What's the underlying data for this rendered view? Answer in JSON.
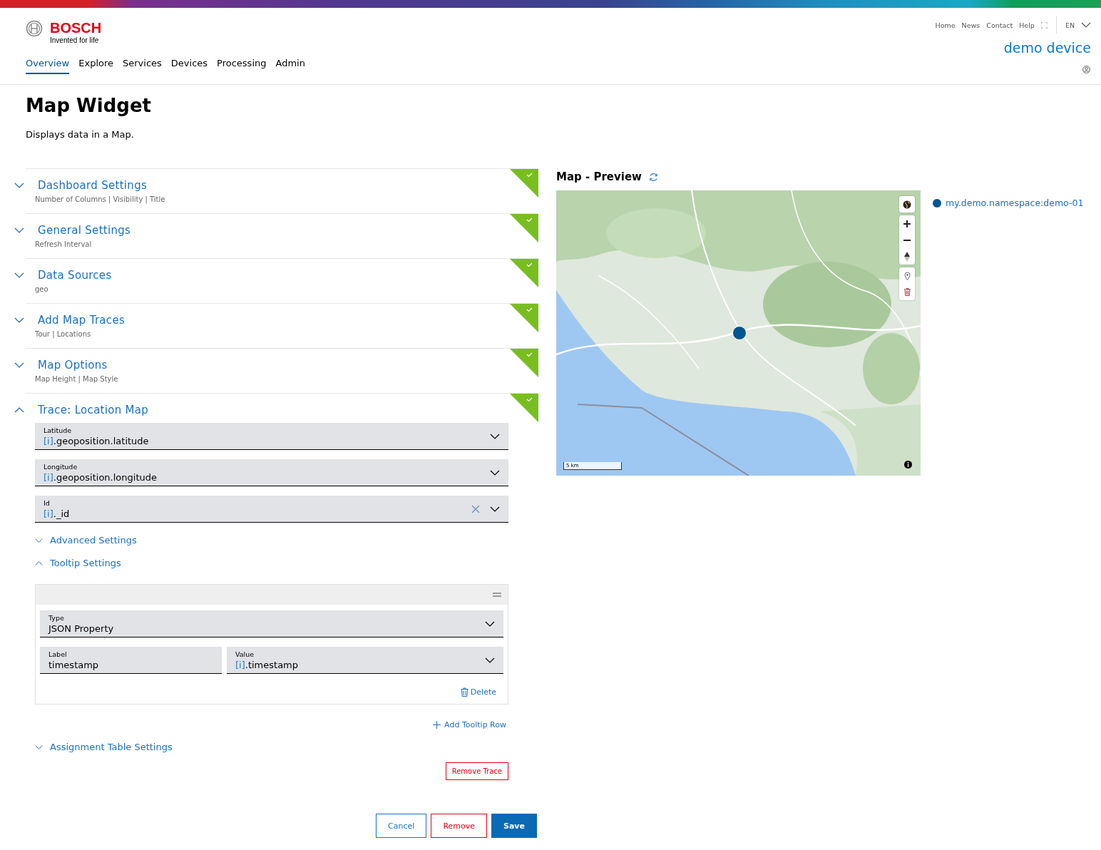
{
  "brand": {
    "name": "BOSCH",
    "tagline": "Invented for life"
  },
  "util_links": [
    "Home",
    "News",
    "Contact",
    "Help"
  ],
  "language": "EN",
  "device": "demo device",
  "nav": [
    {
      "label": "Overview",
      "selected": true
    },
    {
      "label": "Explore",
      "selected": false
    },
    {
      "label": "Services",
      "selected": false
    },
    {
      "label": "Devices",
      "selected": false
    },
    {
      "label": "Processing",
      "selected": false
    },
    {
      "label": "Admin",
      "selected": false
    }
  ],
  "page": {
    "title": "Map Widget",
    "description": "Displays data in a Map."
  },
  "sections": [
    {
      "title": "Dashboard Settings",
      "subtitle": "Number of Columns | Visibility | Title",
      "expanded": false,
      "complete": true
    },
    {
      "title": "General Settings",
      "subtitle": "Refresh Interval",
      "expanded": false,
      "complete": true
    },
    {
      "title": "Data Sources",
      "subtitle": "geo",
      "expanded": false,
      "complete": true
    },
    {
      "title": "Add Map Traces",
      "subtitle": "Tour | Locations",
      "expanded": false,
      "complete": true
    },
    {
      "title": "Map Options",
      "subtitle": "Map Height | Map Style",
      "expanded": false,
      "complete": true
    },
    {
      "title": "Trace: Location Map",
      "expanded": true,
      "complete": true
    }
  ],
  "trace": {
    "fields": [
      {
        "label": "Latitude",
        "prefix": "[i]",
        "value": ".geoposition.latitude",
        "clearable": false
      },
      {
        "label": "Longitude",
        "prefix": "[i]",
        "value": ".geoposition.longitude",
        "clearable": false
      },
      {
        "label": "Id",
        "prefix": "[i]",
        "value": "._id",
        "clearable": true
      }
    ],
    "subsections": [
      {
        "title": "Advanced Settings",
        "expanded": false
      },
      {
        "title": "Tooltip Settings",
        "expanded": true
      }
    ],
    "tooltip_row": {
      "type": {
        "label": "Type",
        "value": "JSON Property"
      },
      "label_field": {
        "label": "Label",
        "value": "timestamp"
      },
      "value_field": {
        "label": "Value",
        "prefix": "[i]",
        "value": ".timestamp"
      },
      "delete": "Delete"
    },
    "add_row": "Add Tooltip Row",
    "after": [
      {
        "title": "Assignment Table Settings",
        "expanded": false
      }
    ],
    "remove_trace": "Remove Trace"
  },
  "preview": {
    "title": "Map - Preview",
    "scale": "5 km",
    "legend": [
      {
        "label": "my.demo.namespace:demo-01",
        "color": "#005691"
      }
    ]
  },
  "buttons": [
    "Cancel",
    "Remove",
    "Save"
  ]
}
